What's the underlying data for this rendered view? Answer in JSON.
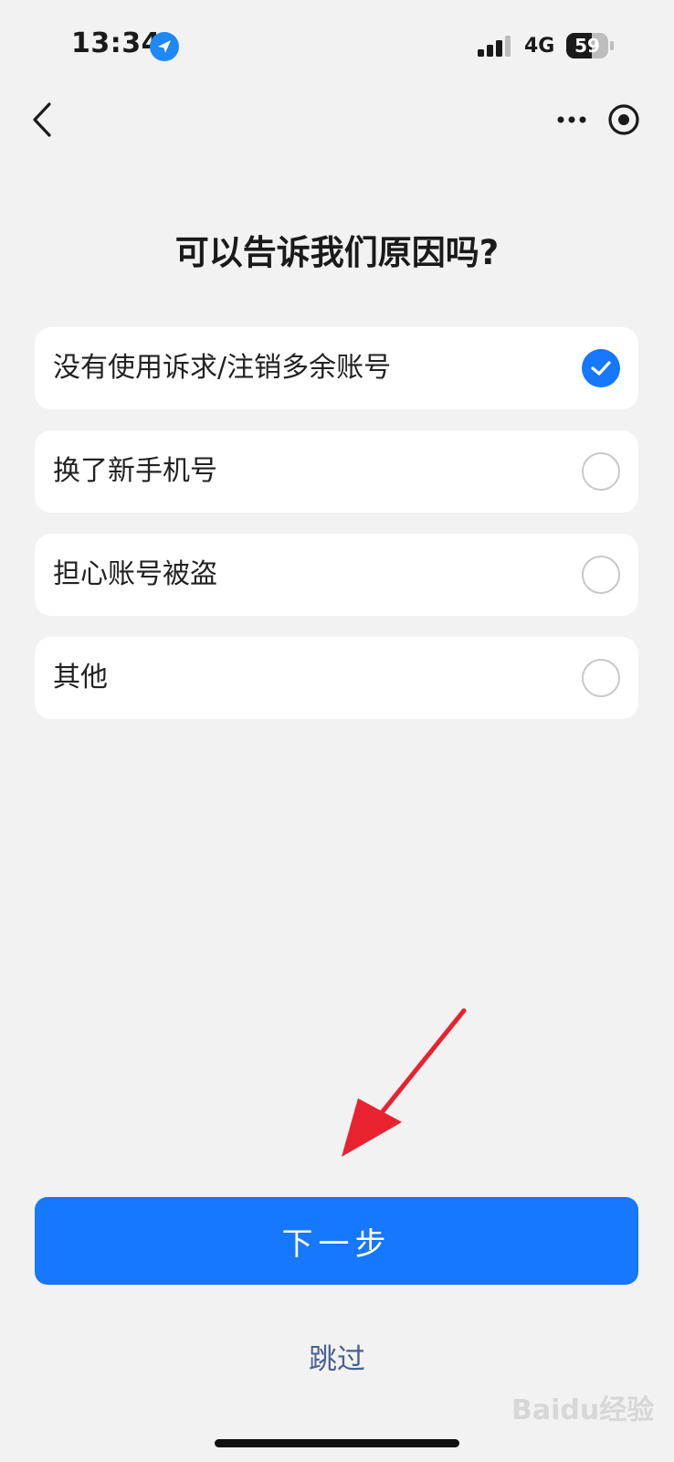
{
  "status_bar": {
    "time": "13:34",
    "network": "4G",
    "battery": "59"
  },
  "title": "可以告诉我们原因吗?",
  "options": [
    {
      "label": "没有使用诉求/注销多余账号",
      "checked": true
    },
    {
      "label": "换了新手机号",
      "checked": false
    },
    {
      "label": "担心账号被盗",
      "checked": false
    },
    {
      "label": "其他",
      "checked": false
    }
  ],
  "buttons": {
    "next": "下一步",
    "skip": "跳过"
  },
  "watermark": "Baidu经验",
  "colors": {
    "accent": "#1677ff",
    "background": "#f2f2f2",
    "annotation_arrow": "#e8232f"
  }
}
